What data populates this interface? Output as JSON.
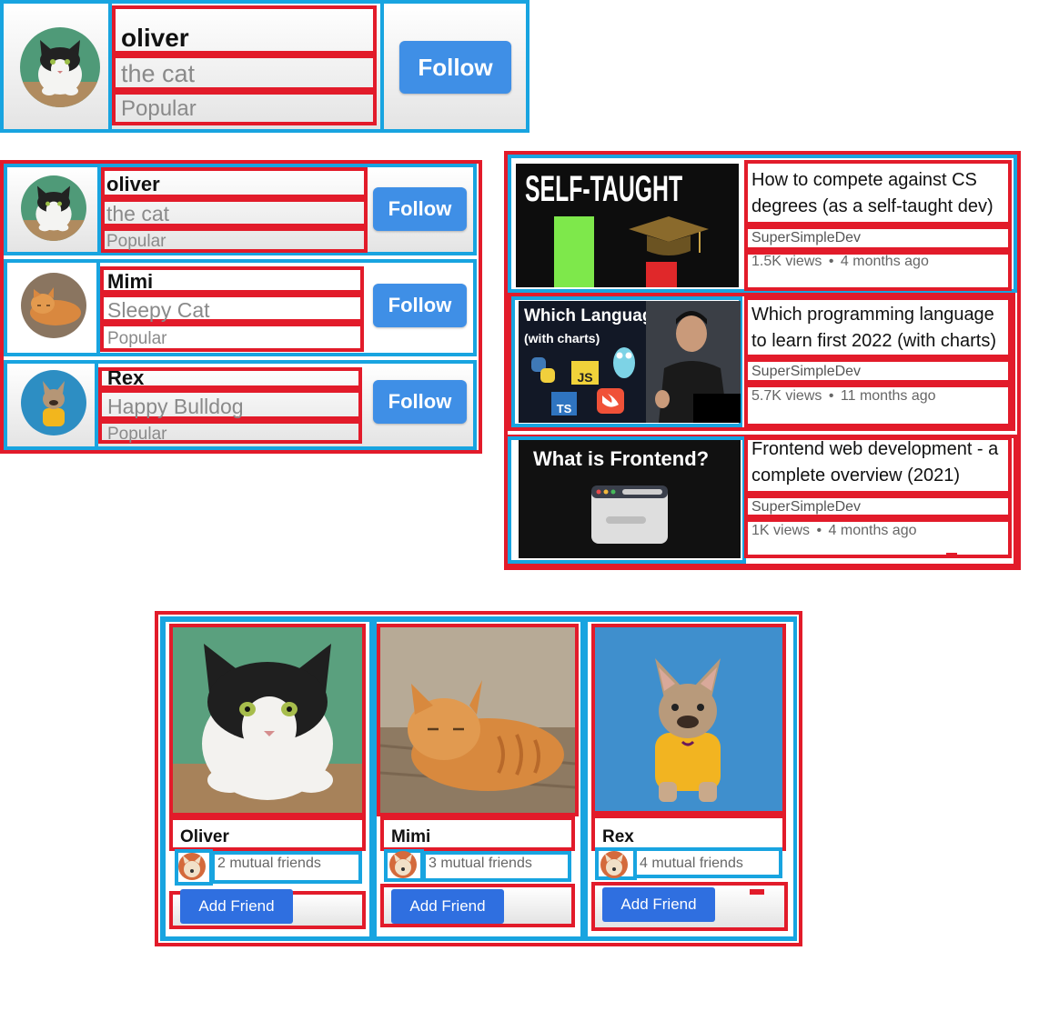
{
  "profile_card": {
    "name": "oliver",
    "subtitle": "the cat",
    "tag": "Popular",
    "button": "Follow"
  },
  "list": [
    {
      "name": "oliver",
      "subtitle": "the cat",
      "tag": "Popular",
      "button": "Follow"
    },
    {
      "name": "Mimi",
      "subtitle": "Sleepy Cat",
      "tag": "Popular",
      "button": "Follow"
    },
    {
      "name": "Rex",
      "subtitle": "Happy Bulldog",
      "tag": "Popular",
      "button": "Follow"
    }
  ],
  "videos": [
    {
      "thumb_text": "SELF-TAUGHT",
      "title": "How to compete against CS degrees (as a self-taught dev)",
      "channel": "SuperSimpleDev",
      "views": "1.5K views",
      "age": "4 months ago"
    },
    {
      "thumb_text": "Which Language?",
      "thumb_text_2": "(with charts)",
      "title": "Which programming language to learn first 2022 (with charts)",
      "channel": "SuperSimpleDev",
      "views": "5.7K views",
      "age": "11 months ago",
      "thumb_badges": [
        "JS",
        "TS"
      ]
    },
    {
      "thumb_text": "What is Frontend?",
      "title": "Frontend web development - a complete overview (2021)",
      "channel": "SuperSimpleDev",
      "views": "1K views",
      "age": "4 months ago"
    }
  ],
  "separator": "•",
  "friends": [
    {
      "name": "Oliver",
      "mutual": "2 mutual friends",
      "button": "Add Friend"
    },
    {
      "name": "Mimi",
      "mutual": "3 mutual friends",
      "button": "Add Friend"
    },
    {
      "name": "Rex",
      "mutual": "4 mutual friends",
      "button": "Add Friend"
    }
  ]
}
